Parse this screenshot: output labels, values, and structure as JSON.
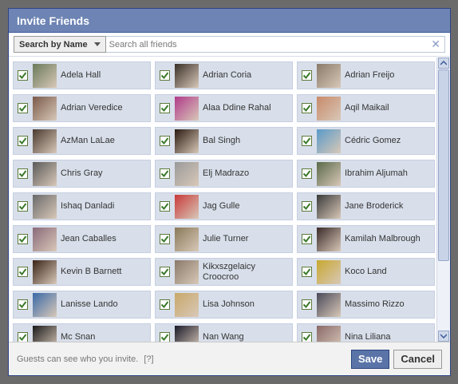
{
  "dialog": {
    "title": "Invite Friends"
  },
  "toolbar": {
    "filter_label": "Search by Name",
    "search_placeholder": "Search all friends",
    "search_value": ""
  },
  "friends": [
    {
      "name": "Adela Hall",
      "checked": true,
      "color": "#6a7a5a"
    },
    {
      "name": "Adrian Coria",
      "checked": true,
      "color": "#3a3028"
    },
    {
      "name": "Adrian Freijo",
      "checked": true,
      "color": "#8a7a6a"
    },
    {
      "name": "Adrian Veredice",
      "checked": true,
      "color": "#7a5a4a"
    },
    {
      "name": "Alaa Ddine Rahal",
      "checked": true,
      "color": "#b03a8a"
    },
    {
      "name": "Aqil Maikail",
      "checked": true,
      "color": "#c88a6a"
    },
    {
      "name": "AzMan LaLae",
      "checked": true,
      "color": "#4a3a30"
    },
    {
      "name": "Bal Singh",
      "checked": true,
      "color": "#2a1a10"
    },
    {
      "name": "Cédric Gomez",
      "checked": true,
      "color": "#5a9ac8"
    },
    {
      "name": "Chris Gray",
      "checked": true,
      "color": "#5a5a5a"
    },
    {
      "name": "Elj Madrazo",
      "checked": true,
      "color": "#9a9a9a"
    },
    {
      "name": "Ibrahim Aljumah",
      "checked": true,
      "color": "#5a6a4a"
    },
    {
      "name": "Ishaq Danladi",
      "checked": true,
      "color": "#6a6a6a"
    },
    {
      "name": "Jag Gulle",
      "checked": true,
      "color": "#c83a3a"
    },
    {
      "name": "Jane Broderick",
      "checked": true,
      "color": "#3a3a3a"
    },
    {
      "name": "Jean Caballes",
      "checked": true,
      "color": "#8a6a7a"
    },
    {
      "name": "Julie Turner",
      "checked": true,
      "color": "#8a7a5a"
    },
    {
      "name": "Kamilah Malbrough",
      "checked": true,
      "color": "#3a2a2a"
    },
    {
      "name": "Kevin B Barnett",
      "checked": true,
      "color": "#3a2418"
    },
    {
      "name": "Kikxszgelaicy Croocroo",
      "checked": true,
      "color": "#8a7a6a"
    },
    {
      "name": "Koco Land",
      "checked": true,
      "color": "#c8a830"
    },
    {
      "name": "Lanisse Lando",
      "checked": true,
      "color": "#3a6aa8"
    },
    {
      "name": "Lisa Johnson",
      "checked": true,
      "color": "#c8a86a"
    },
    {
      "name": "Massimo Rizzo",
      "checked": true,
      "color": "#4a4a5a"
    },
    {
      "name": "Mc Snan",
      "checked": true,
      "color": "#1a1a1a"
    },
    {
      "name": "Nan Wang",
      "checked": true,
      "color": "#1a1a2a"
    },
    {
      "name": "Nina Liliana",
      "checked": true,
      "color": "#8a6a6a"
    }
  ],
  "footer": {
    "note": "Guests can see who you invite.",
    "help_label": "[?]",
    "save_label": "Save",
    "cancel_label": "Cancel"
  },
  "colors": {
    "title_bar": "#6d84b4",
    "row_bg": "#d8dfea",
    "check": "#3a7a2a",
    "save_bg": "#5b74a8"
  }
}
